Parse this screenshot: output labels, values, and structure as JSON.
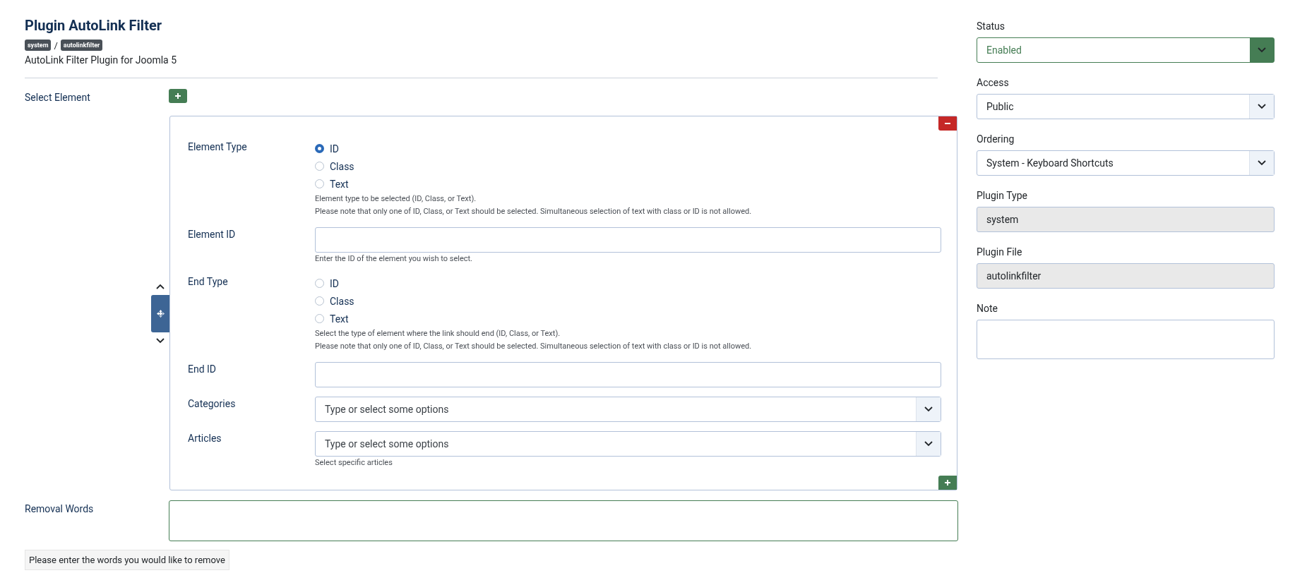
{
  "header": {
    "title": "Plugin AutoLink Filter",
    "badges": [
      "system",
      "autolinkfilter"
    ],
    "separator": "/",
    "description": "AutoLink Filter Plugin for Joomla 5"
  },
  "select_element": {
    "label": "Select Element",
    "subform": {
      "fields": [
        {
          "kind": "radio",
          "label": "Element Type",
          "options": [
            {
              "label": "ID",
              "selected": true
            },
            {
              "label": "Class",
              "selected": false
            },
            {
              "label": "Text",
              "selected": false
            }
          ],
          "hints": [
            "Element type to be selected (ID, Class, or Text).",
            "Please note that only one of ID, Class, or Text should be selected. Simultaneous selection of text with class or ID is not allowed."
          ]
        },
        {
          "kind": "text",
          "label": "Element ID",
          "hints": [
            "Enter the ID of the element you wish to select."
          ]
        },
        {
          "kind": "radio",
          "label": "End Type",
          "options": [
            {
              "label": "ID",
              "selected": false
            },
            {
              "label": "Class",
              "selected": false
            },
            {
              "label": "Text",
              "selected": false
            }
          ],
          "hints": [
            "Select the type of element where the link should end (ID, Class, or Text).",
            "Please note that only one of ID, Class, or Text should be selected. Simultaneous selection of text with class or ID is not allowed."
          ]
        },
        {
          "kind": "text",
          "label": "End ID"
        },
        {
          "kind": "multiselect",
          "label": "Categories",
          "placeholder": "Type or select some options"
        },
        {
          "kind": "multiselect",
          "label": "Articles",
          "placeholder": "Type or select some options",
          "hints": [
            "Select specific articles"
          ]
        }
      ]
    }
  },
  "removal_words": {
    "label": "Removal Words",
    "hint": "Please enter the words you would like to remove"
  },
  "sidebar": {
    "fields": [
      {
        "kind": "status-select",
        "label": "Status",
        "value": "Enabled"
      },
      {
        "kind": "select",
        "label": "Access",
        "value": "Public"
      },
      {
        "kind": "select",
        "label": "Ordering",
        "value": "System - Keyboard Shortcuts"
      },
      {
        "kind": "readonly",
        "label": "Plugin Type",
        "value": "system"
      },
      {
        "kind": "readonly",
        "label": "Plugin File",
        "value": "autolinkfilter"
      },
      {
        "kind": "textarea",
        "label": "Note"
      }
    ]
  }
}
